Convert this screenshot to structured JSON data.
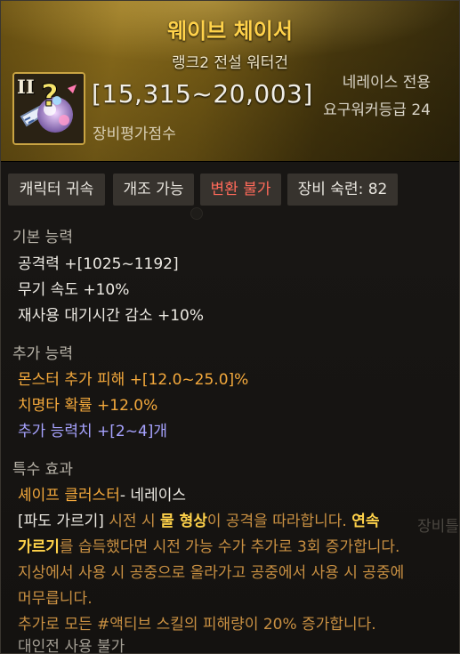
{
  "item": {
    "name": "웨이브 체이서",
    "rank_type": "랭크2 전설 워터건",
    "score_range": "[15,315~20,003]",
    "score_label": "장비평가점수",
    "exclusive": "네레이스 전용",
    "required_level": "요구워커등급 24",
    "rank_numeral": "II"
  },
  "tags": [
    "캐릭터 귀속",
    "개조 가능",
    "변환 불가",
    "장비 숙련: 82"
  ],
  "basic": {
    "title": "기본 능력",
    "lines": [
      "공격력  +[1025~1192]",
      "무기 속도 +10%",
      "재사용 대기시간 감소 +10%"
    ]
  },
  "extra": {
    "title": "추가 능력",
    "lines": [
      "몬스터 추가 피해  +[12.0~25.0]%",
      "치명타 확률  +12.0%",
      "추가 능력치 +[2~4]개"
    ]
  },
  "special": {
    "title": "특수 효과",
    "name": "셰이프 클러스터",
    "owner": "- 네레이스",
    "p1_a": "[파도 가르기]",
    "p1_b": " 시전 시 ",
    "p1_c": "물 형상",
    "p1_d": "이 공격을 따라합니다. ",
    "p1_e": "연속",
    "p2_a": "가르기",
    "p2_b": "를 습득했다면 시전 가능 수가 추가로 3회 증가합니다.",
    "p3": "지상에서 사용 시 공중으로 올라가고 공중에서 사용 시 공중에",
    "p4": "머무릅니다.",
    "p5": "추가로 모든 #액티브 스킬의 피해량이 20% 증가합니다.",
    "p6": "대인전 사용 불가"
  },
  "background_ghost": "장비틀",
  "colors": {
    "title": "#ffd24a",
    "orange": "#f4a93c",
    "red": "#ff6a5a",
    "purple": "#a7a3ff"
  }
}
